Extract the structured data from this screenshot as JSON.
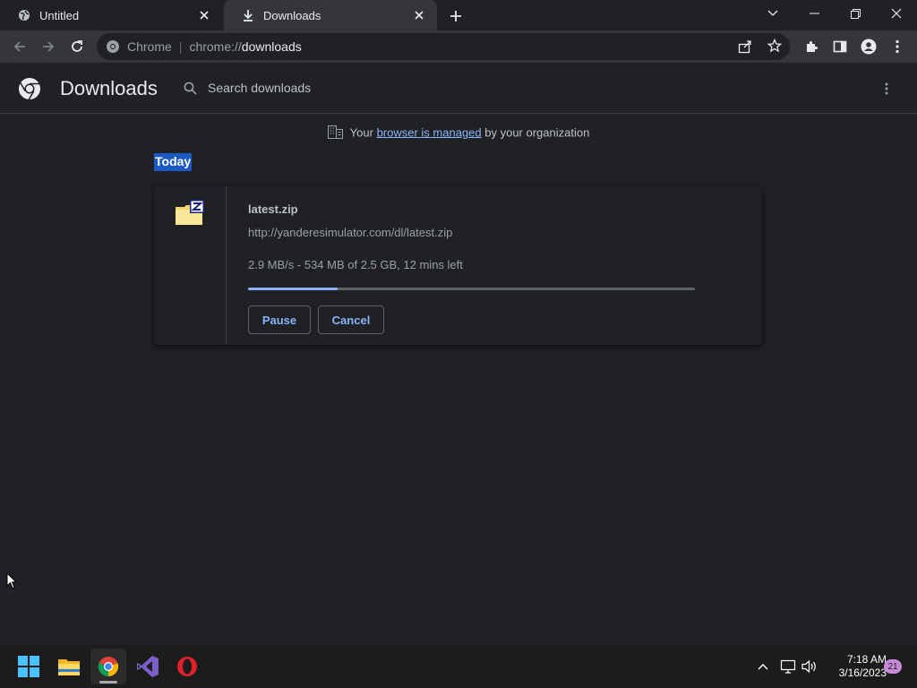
{
  "tabs": [
    {
      "label": "Untitled",
      "icon": "globe-icon"
    },
    {
      "label": "Downloads",
      "icon": "download-icon",
      "active": true
    }
  ],
  "omnibox": {
    "site_name": "Chrome",
    "separator": "|",
    "scheme": "chrome://",
    "host": "downloads"
  },
  "page": {
    "title": "Downloads",
    "search_placeholder": "Search downloads",
    "managed": {
      "prefix": "Your",
      "link": "browser is managed",
      "suffix": "by your organization"
    },
    "date_header": "Today"
  },
  "download": {
    "file_name": "latest.zip",
    "url": "http://yanderesimulator.com/dl/latest.zip",
    "progress_text": "2.9 MB/s - 534 MB of 2.5 GB, 12 mins left",
    "progress_fraction": 0.2,
    "pause_label": "Pause",
    "cancel_label": "Cancel"
  },
  "taskbar": {
    "apps": [
      "windows-start",
      "file-explorer",
      "chrome",
      "visual-studio",
      "opera"
    ],
    "time": "7:18 AM",
    "date": "3/16/2023",
    "notification_count": "21"
  },
  "colors": {
    "accent": "#8ab4f8",
    "selection": "#1a5ac2",
    "background": "#202124",
    "toolbar": "#35363a"
  }
}
